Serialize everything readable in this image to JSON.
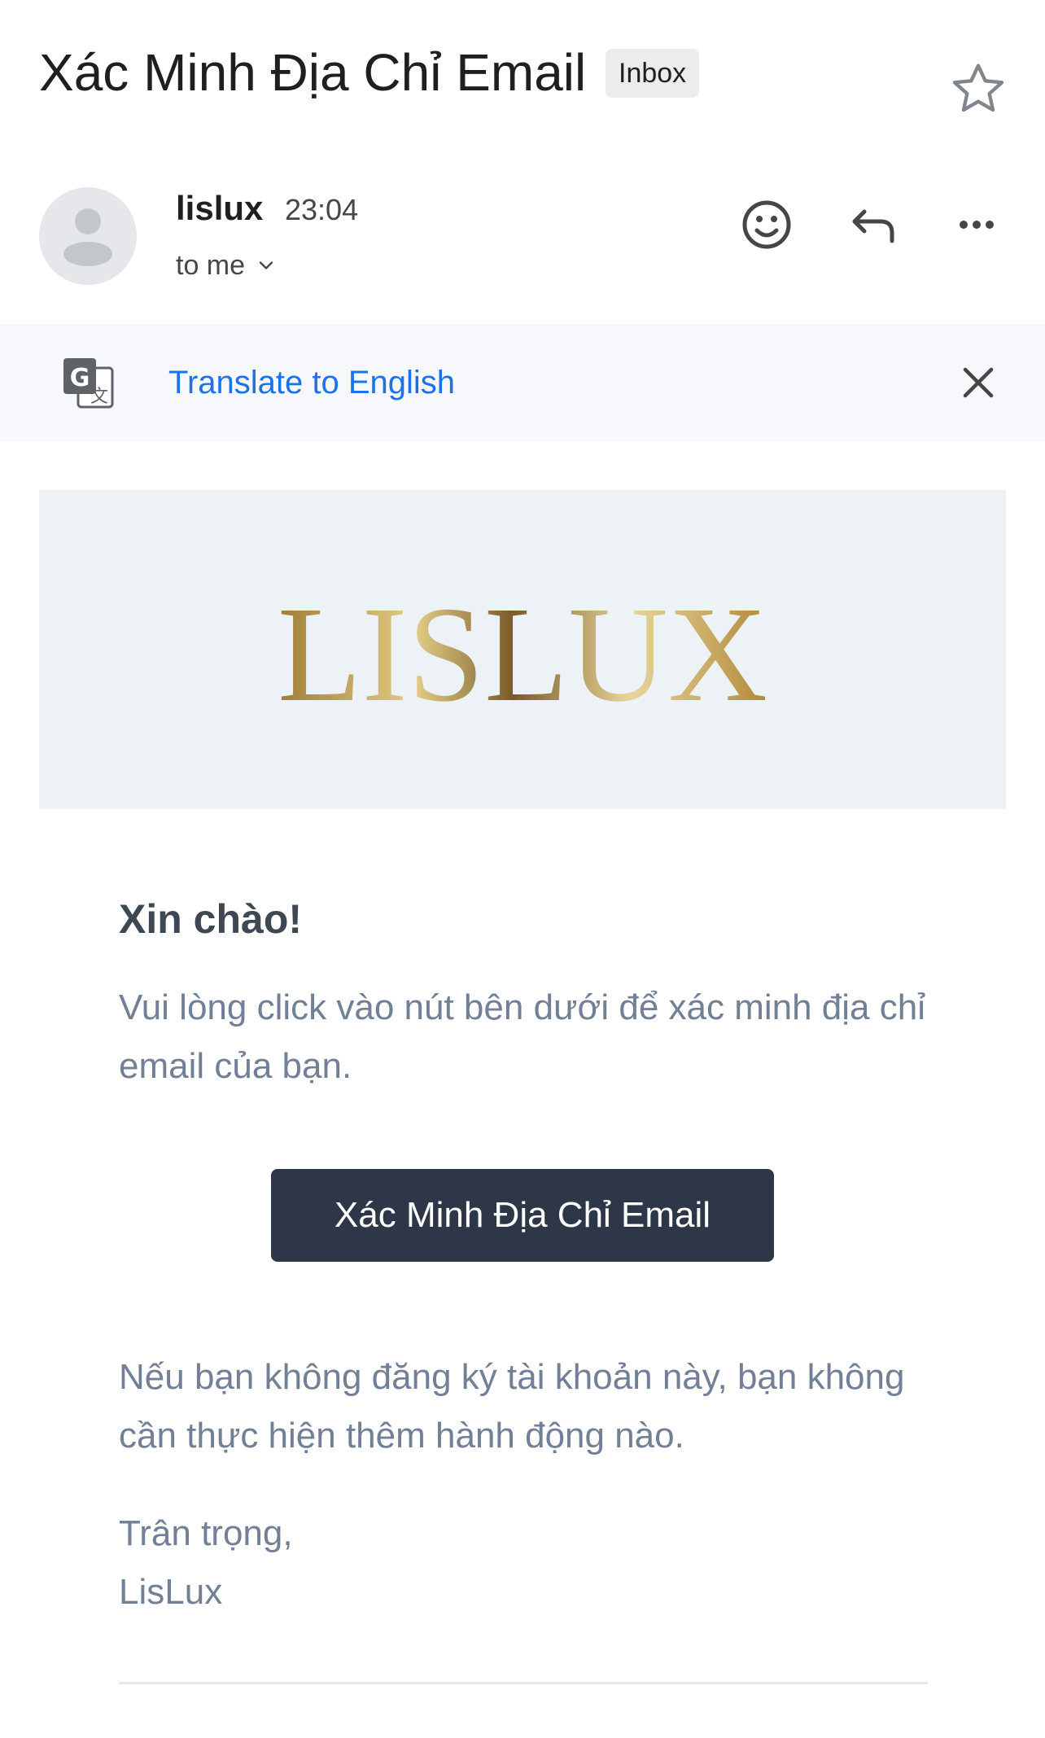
{
  "header": {
    "subject": "Xác Minh Địa Chỉ Email",
    "label_badge": "Inbox",
    "star_icon": "star-outline-icon"
  },
  "sender": {
    "name": "lislux",
    "time": "23:04",
    "recipient": "to me",
    "avatar_icon": "default-avatar-icon",
    "actions": {
      "emoji_icon": "add-reaction-icon",
      "reply_icon": "reply-icon",
      "more_icon": "more-horizontal-icon"
    }
  },
  "translate_bar": {
    "link_text": "Translate to English",
    "icon": "google-translate-icon",
    "close_icon": "close-icon",
    "link_color": "#1a73e8",
    "background": "#f6f8fc"
  },
  "email": {
    "brand_logo_text": "LISLUX",
    "greeting": "Xin chào!",
    "intro": "Vui lòng click vào nút bên dưới để xác minh địa chỉ email của bạn.",
    "button_label": "Xác Minh Địa Chỉ Email",
    "disclaimer": "Nếu bạn không đăng ký tài khoản này, bạn không cần thực hiện thêm hành động nào.",
    "closing": "Trân trọng,",
    "signature": "LisLux",
    "colors": {
      "button_bg": "#2d3748",
      "banner_bg": "#edf2f7",
      "heading": "#3d4852",
      "body_text": "#718096",
      "logo_gold": "#b8933f"
    }
  }
}
